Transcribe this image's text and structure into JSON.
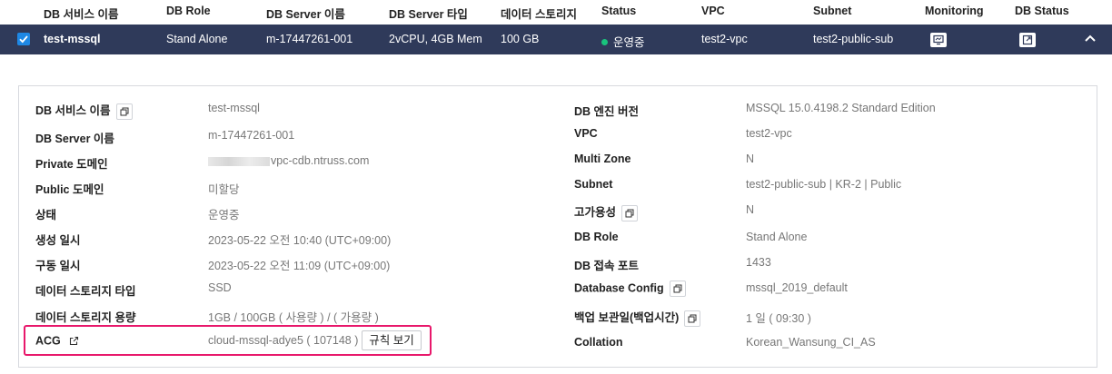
{
  "header": {
    "service_name": "DB 서비스 이름",
    "db_role": "DB Role",
    "server_name": "DB Server 이름",
    "server_type": "DB Server 타입",
    "storage": "데이터 스토리지",
    "status": "Status",
    "vpc": "VPC",
    "subnet": "Subnet",
    "monitoring": "Monitoring",
    "db_status": "DB Status"
  },
  "row": {
    "checked": true,
    "service_name": "test-mssql",
    "db_role": "Stand Alone",
    "server_name": "m-17447261-001",
    "server_type": "2vCPU, 4GB Mem",
    "storage": "100 GB",
    "status": "운영중",
    "status_color": "#19c37d",
    "vpc": "test2-vpc",
    "subnet": "test2-public-sub",
    "monitoring_icon": "monitor-icon",
    "db_status_icon": "external-link-icon",
    "expand_icon": "chevron-up-icon"
  },
  "details_left": [
    {
      "label": "DB 서비스 이름",
      "value": "test-mssql",
      "copy": true
    },
    {
      "label": "DB Server 이름",
      "value": "m-17447261-001"
    },
    {
      "label": "Private 도메인",
      "value": "vpc-cdb.ntruss.com",
      "masked_prefix": true
    },
    {
      "label": "Public 도메인",
      "value": "미할당"
    },
    {
      "label": "상태",
      "value": "운영중"
    },
    {
      "label": "생성 일시",
      "value": "2023-05-22 오전 10:40 (UTC+09:00)"
    },
    {
      "label": "구동 일시",
      "value": "2023-05-22 오전 11:09 (UTC+09:00)"
    },
    {
      "label": "데이터 스토리지 타입",
      "value": "SSD"
    },
    {
      "label": "데이터 스토리지 용량",
      "value": "1GB / 100GB ( 사용량 ) / ( 가용량 )"
    },
    {
      "label": "ACG",
      "value": "cloud-mssql-adye5 ( 107148 )",
      "link": true,
      "button": "규칙 보기"
    }
  ],
  "details_right": [
    {
      "label": "DB 엔진 버전",
      "value": "MSSQL 15.0.4198.2 Standard Edition"
    },
    {
      "label": "VPC",
      "value": "test2-vpc"
    },
    {
      "label": "Multi Zone",
      "value": "N"
    },
    {
      "label": "Subnet",
      "value": "test2-public-sub | KR-2 | Public"
    },
    {
      "label": "고가용성",
      "value": "N",
      "copy": true
    },
    {
      "label": "DB Role",
      "value": "Stand Alone"
    },
    {
      "label": "DB 접속 포트",
      "value": "1433"
    },
    {
      "label": "Database Config",
      "value": "mssql_2019_default",
      "copy": true
    },
    {
      "label": "백업 보관일(백업시간)",
      "value": "1 일 ( 09:30 )",
      "copy": true
    },
    {
      "label": "Collation",
      "value": "Korean_Wansung_CI_AS"
    }
  ],
  "colors": {
    "selected_row_bg": "#2f3a5a",
    "checkbox": "#1e88e5",
    "highlight_border": "#e8186b"
  }
}
